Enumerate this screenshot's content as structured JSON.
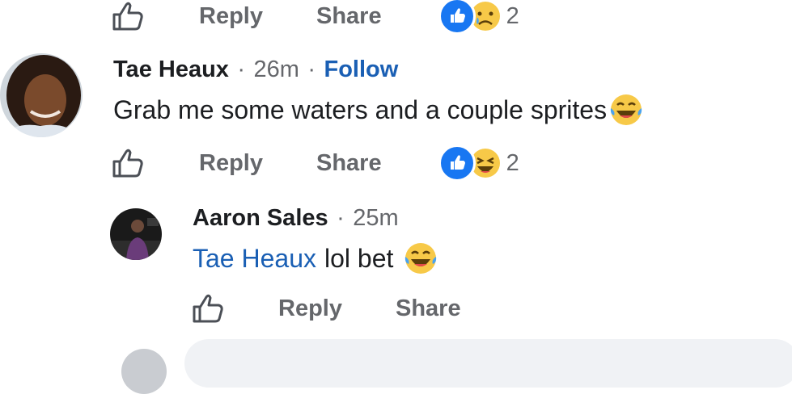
{
  "colors": {
    "accent": "#1a5fb4",
    "like_blue": "#1877f2",
    "muted": "#65676b",
    "text": "#1c1e21",
    "emoji_yellow": "#f7c948"
  },
  "top_actions": {
    "reply_label": "Reply",
    "share_label": "Share",
    "reactions": [
      "like-icon",
      "sad-emoji-icon"
    ],
    "reaction_count": "2"
  },
  "comment_1": {
    "author": "Tae Heaux",
    "separator": "·",
    "time": "26m",
    "follow_label": "Follow",
    "text": "Grab me some waters and a couple sprites",
    "emoji": "laughing-tears-emoji-icon",
    "reply_label": "Reply",
    "share_label": "Share",
    "reactions": [
      "like-icon",
      "laughing-emoji-icon"
    ],
    "reaction_count": "2"
  },
  "reply_1": {
    "author": "Aaron Sales",
    "separator": "·",
    "time": "25m",
    "mention": "Tae Heaux",
    "text": "lol bet",
    "emoji": "laughing-tears-emoji-icon",
    "reply_label": "Reply",
    "share_label": "Share"
  }
}
